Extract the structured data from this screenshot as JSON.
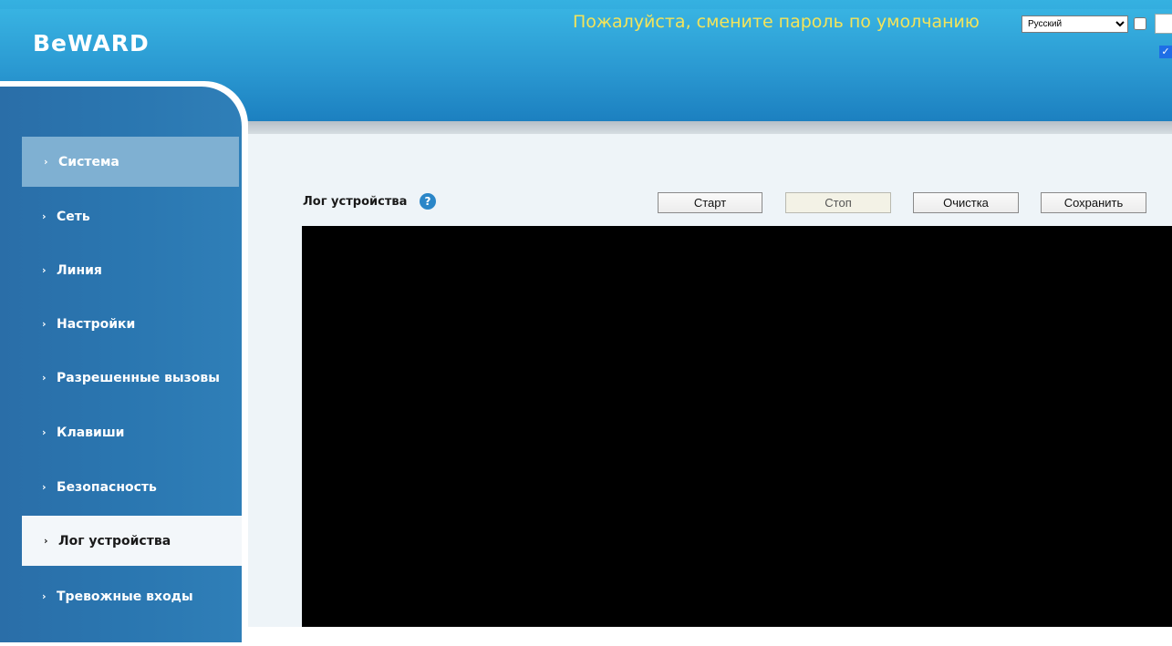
{
  "header": {
    "logo_text": "BeWARD",
    "warning": "Пожалуйста, смените пароль по умолчанию",
    "language": {
      "selected": "Русский",
      "options": [
        "Русский"
      ]
    }
  },
  "sidebar": {
    "items": [
      {
        "label": "Система",
        "state": "expanded"
      },
      {
        "label": "Сеть"
      },
      {
        "label": "Линия"
      },
      {
        "label": "Настройки"
      },
      {
        "label": "Разрешенные вызовы"
      },
      {
        "label": "Клавиши"
      },
      {
        "label": "Безопасность"
      },
      {
        "label": "Лог устройства",
        "state": "active"
      },
      {
        "label": "Тревожные входы"
      }
    ]
  },
  "main": {
    "title": "Лог устройства",
    "buttons": {
      "start": "Старт",
      "stop": "Стоп",
      "clear": "Очистка",
      "save": "Сохранить"
    },
    "log_text": ""
  },
  "colors": {
    "header_blue": "#2a9bd3",
    "sidebar_blue": "#2a76b0",
    "warning_yellow": "#f4e45a",
    "log_background": "#000000"
  }
}
